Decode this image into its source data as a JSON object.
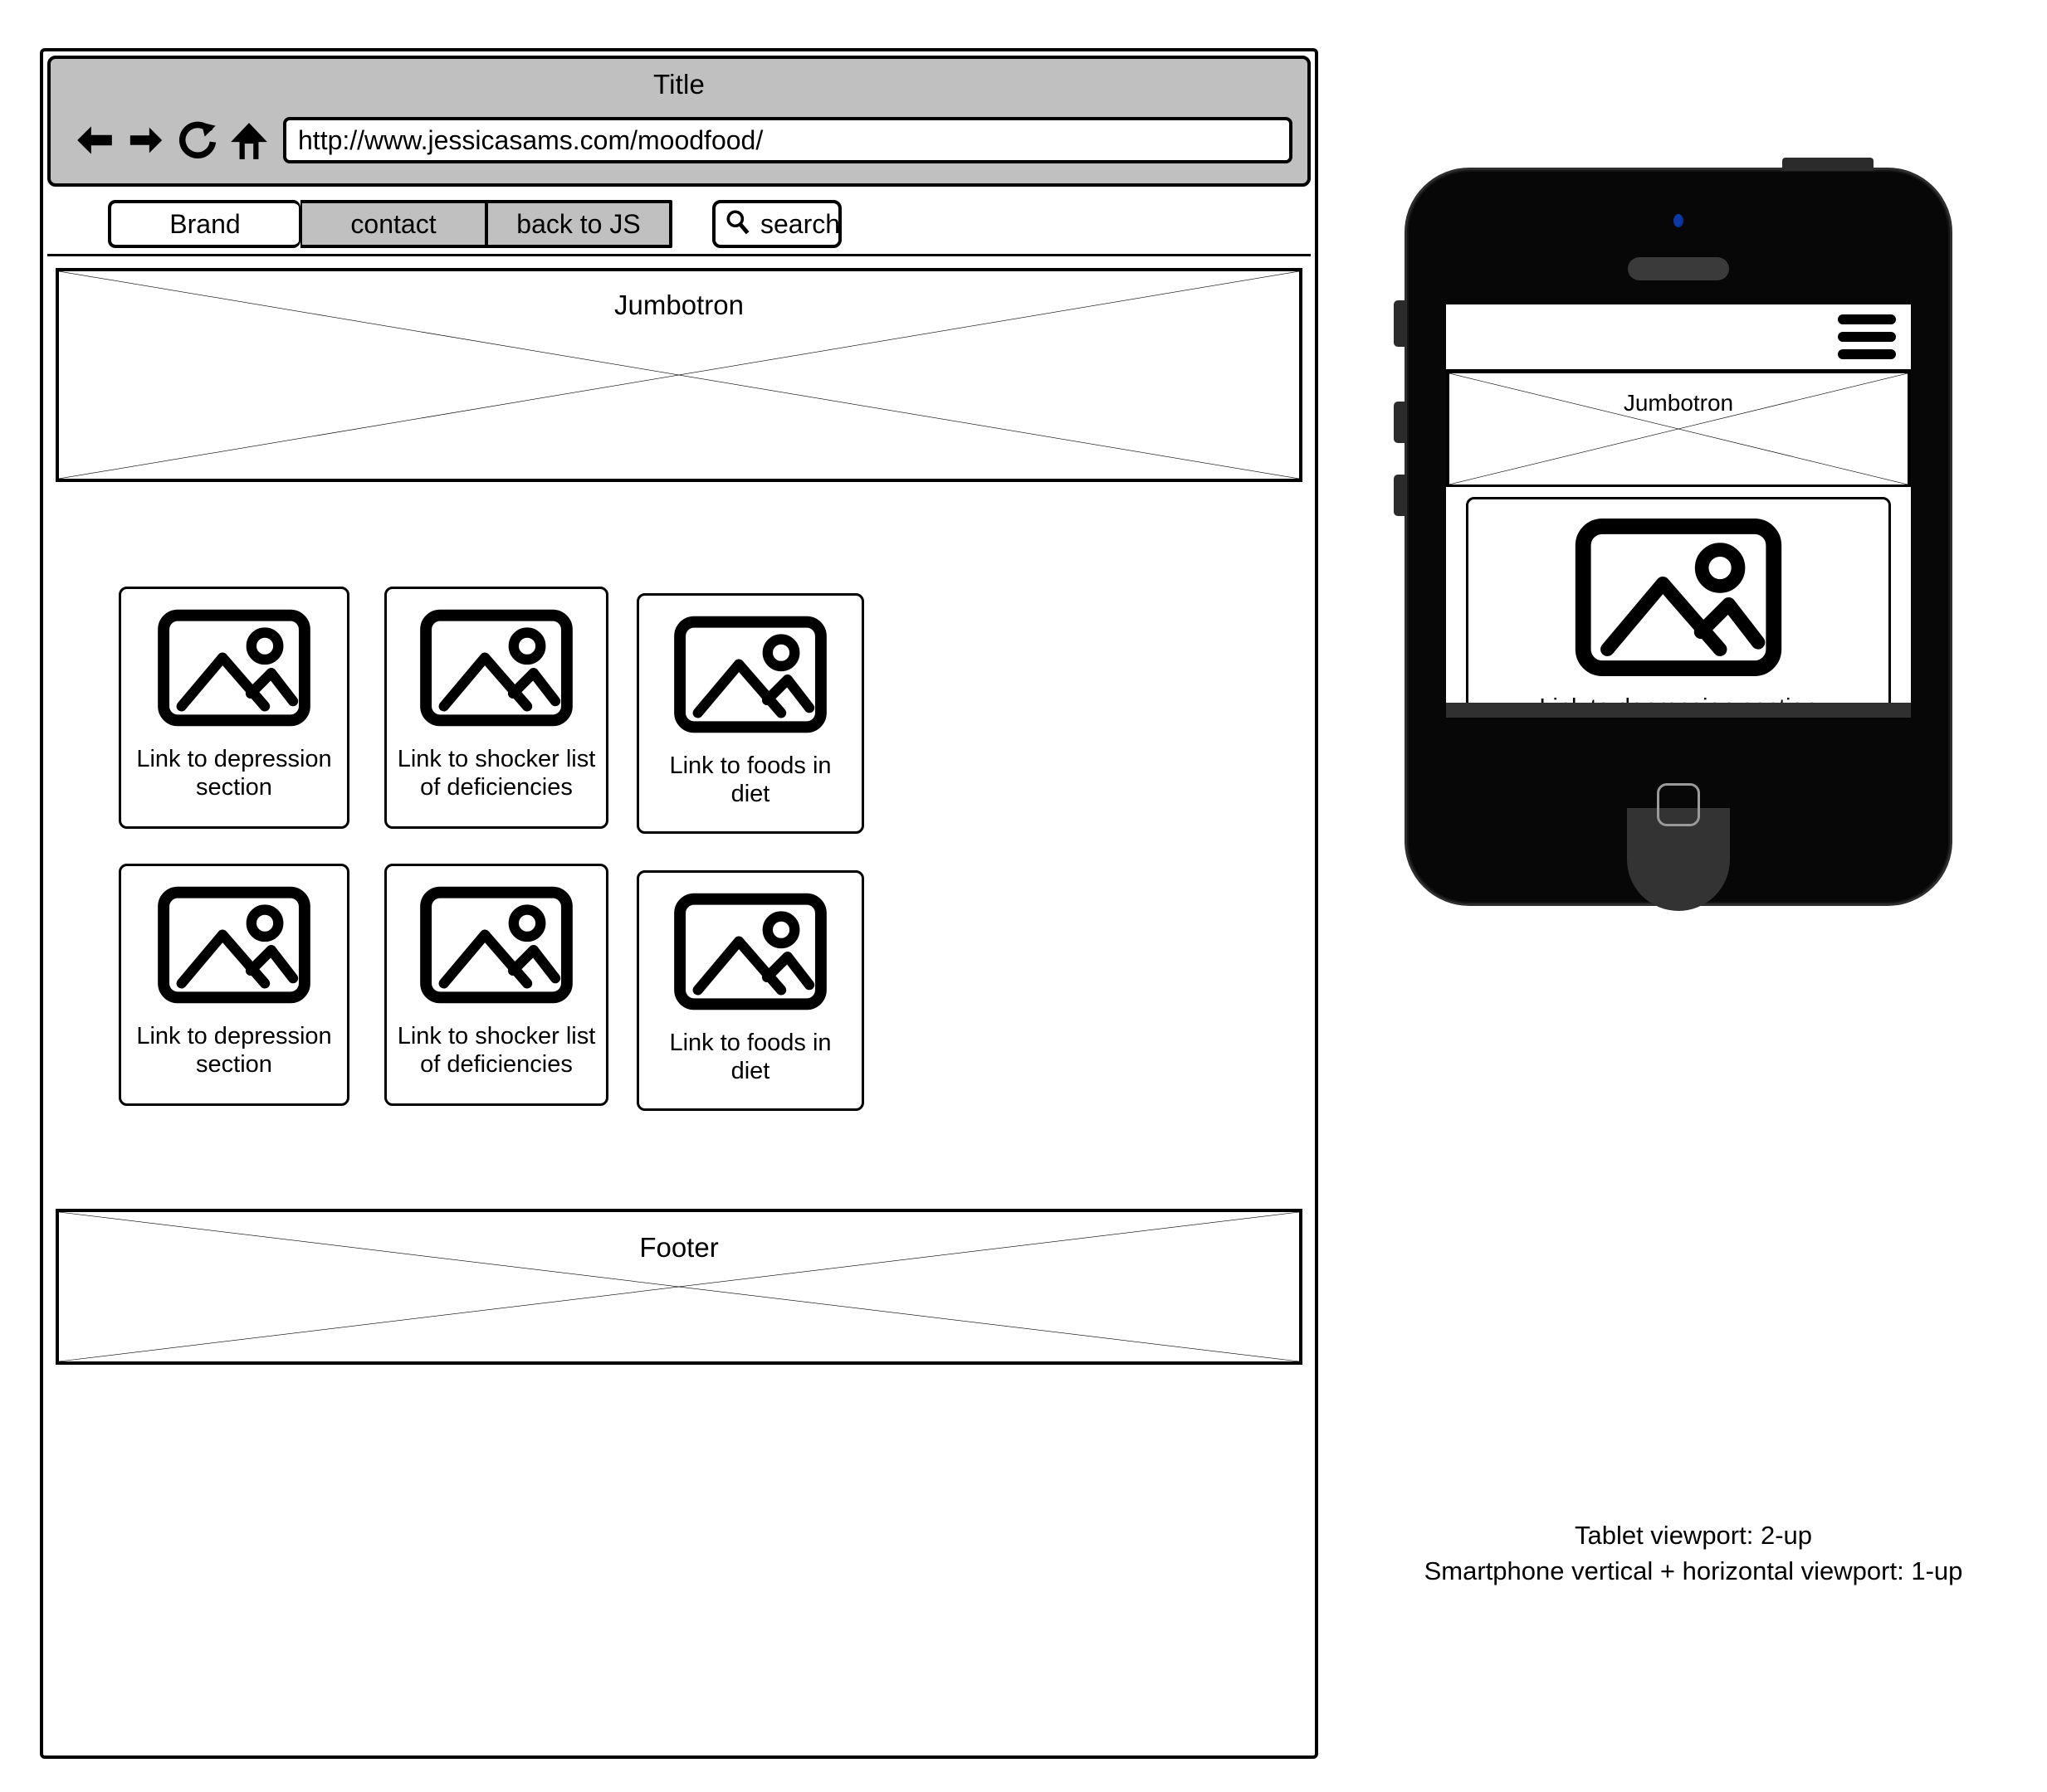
{
  "browser": {
    "title": "Title",
    "url": "http://www.jessicasams.com/moodfood/",
    "controls": [
      {
        "name": "back-button",
        "icon": "arrow-left-icon"
      },
      {
        "name": "forward-button",
        "icon": "arrow-right-icon"
      },
      {
        "name": "reload-button",
        "icon": "reload-icon"
      },
      {
        "name": "home-button",
        "icon": "home-icon"
      }
    ]
  },
  "site_nav": {
    "brand": "Brand",
    "items": [
      {
        "label": "contact"
      },
      {
        "label": "back to JS"
      }
    ],
    "search": {
      "label": "search",
      "icon": "search-icon"
    }
  },
  "jumbotron": {
    "label": "Jumbotron"
  },
  "cards": {
    "row1": [
      {
        "label": "Link to depression section",
        "icon": "image-placeholder-icon"
      },
      {
        "label": "Link to shocker list of deficiencies",
        "icon": "image-placeholder-icon"
      },
      {
        "label": "Link to foods in diet",
        "icon": "image-placeholder-icon"
      }
    ],
    "row2": [
      {
        "label": "Link to depression section",
        "icon": "image-placeholder-icon"
      },
      {
        "label": "Link to shocker list of deficiencies",
        "icon": "image-placeholder-icon"
      },
      {
        "label": "Link to foods in diet",
        "icon": "image-placeholder-icon"
      }
    ]
  },
  "footer": {
    "label": "Footer"
  },
  "phone": {
    "menu_icon": "hamburger-menu-icon",
    "jumbotron_label": "Jumbotron",
    "cards": [
      {
        "label": "Link to depression section",
        "icon": "image-placeholder-icon"
      },
      {
        "label": "",
        "icon": "image-placeholder-icon"
      }
    ]
  },
  "caption": {
    "line1": "Tablet viewport: 2-up",
    "line2": "Smartphone vertical + horizontal viewport: 1-up"
  },
  "colors": {
    "chrome_gray": "#c0c0c0",
    "stroke_black": "#000000",
    "phone_body": "#070707",
    "camera_blue": "#0b39a8",
    "page_white": "#ffffff"
  }
}
